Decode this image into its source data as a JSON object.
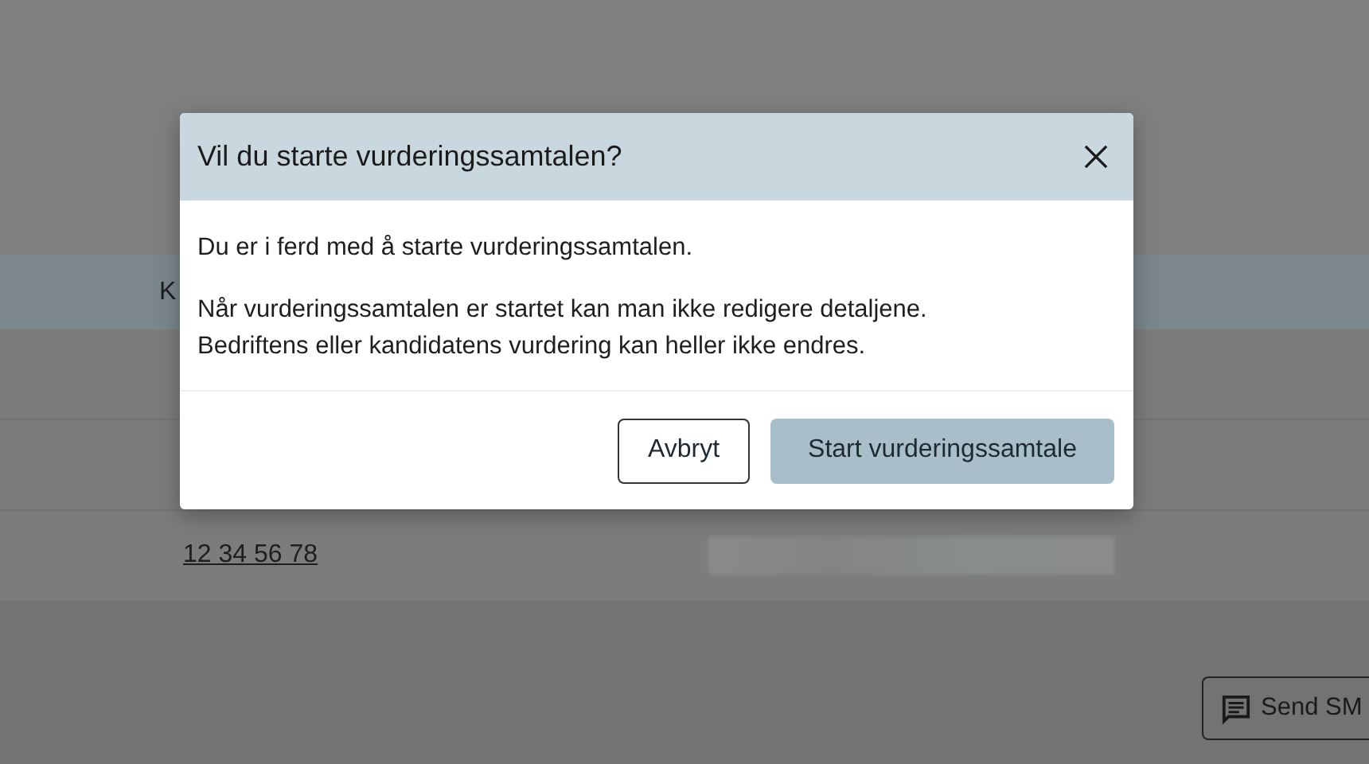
{
  "page": {
    "table_header": {
      "column_1": "K"
    },
    "contact_row": {
      "phone": "12 34 56 78"
    },
    "send_button": "Send SM"
  },
  "dialog": {
    "title": "Vil du starte vurderingssamtalen?",
    "paragraphs": [
      {
        "lines": [
          "Du er i ferd med å starte vurderingssamtalen."
        ]
      },
      {
        "lines": [
          "Når vurderingssamtalen er startet kan man ikke redigere detaljene.",
          "Bedriftens eller kandidatens vurdering kan heller ikke endres."
        ]
      }
    ],
    "buttons": [
      {
        "label": "Avbryt",
        "kind": "secondary"
      },
      {
        "label": "Start vurderingssamtale",
        "kind": "primary"
      }
    ]
  }
}
